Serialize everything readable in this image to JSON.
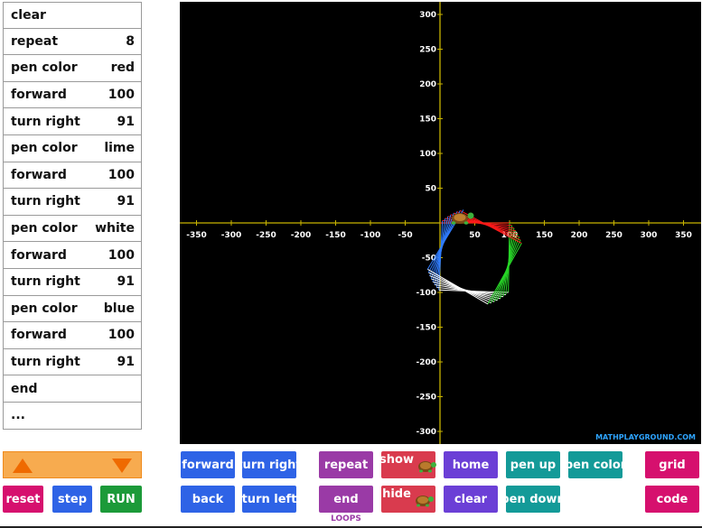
{
  "program": [
    {
      "cmd": "clear",
      "val": ""
    },
    {
      "cmd": "repeat",
      "val": "8"
    },
    {
      "cmd": "pen color",
      "val": "red"
    },
    {
      "cmd": "forward",
      "val": "100"
    },
    {
      "cmd": "turn right",
      "val": "91"
    },
    {
      "cmd": "pen color",
      "val": "lime"
    },
    {
      "cmd": "forward",
      "val": "100"
    },
    {
      "cmd": "turn right",
      "val": "91"
    },
    {
      "cmd": "pen color",
      "val": "white"
    },
    {
      "cmd": "forward",
      "val": "100"
    },
    {
      "cmd": "turn right",
      "val": "91"
    },
    {
      "cmd": "pen color",
      "val": "blue"
    },
    {
      "cmd": "forward",
      "val": "100"
    },
    {
      "cmd": "turn right",
      "val": "91"
    },
    {
      "cmd": "end",
      "val": ""
    },
    {
      "cmd": "...",
      "val": ""
    }
  ],
  "controls": {
    "reset": "reset",
    "step": "step",
    "run": "RUN"
  },
  "buttons": {
    "forward": "forward",
    "turn_right": "turn right",
    "back": "back",
    "turn_left": "turn left",
    "repeat": "repeat",
    "end": "end",
    "show": "show",
    "hide": "hide",
    "home": "home",
    "clear": "clear",
    "pen_up": "pen up",
    "pen_down": "pen down",
    "pen_color": "pen color",
    "grid": "grid",
    "code": "code"
  },
  "loops_label": "LOOPS",
  "canvas": {
    "x_ticks": [
      "-350",
      "-300",
      "-250",
      "-200",
      "-150",
      "-100",
      "-50",
      "50",
      "100",
      "150",
      "200",
      "250",
      "300",
      "350"
    ],
    "y_ticks_pos": [
      "300",
      "250",
      "200",
      "150",
      "100",
      "50"
    ],
    "y_ticks_neg": [
      "-50",
      "-100",
      "-150",
      "-200",
      "-250",
      "-300"
    ],
    "watermark": "MATHPLAYGROUND.COM"
  },
  "colors": {
    "axis": "#c8b400",
    "red": "#ff1a1a",
    "lime": "#27d627",
    "white": "#ffffff",
    "blue": "#2f7cff"
  }
}
